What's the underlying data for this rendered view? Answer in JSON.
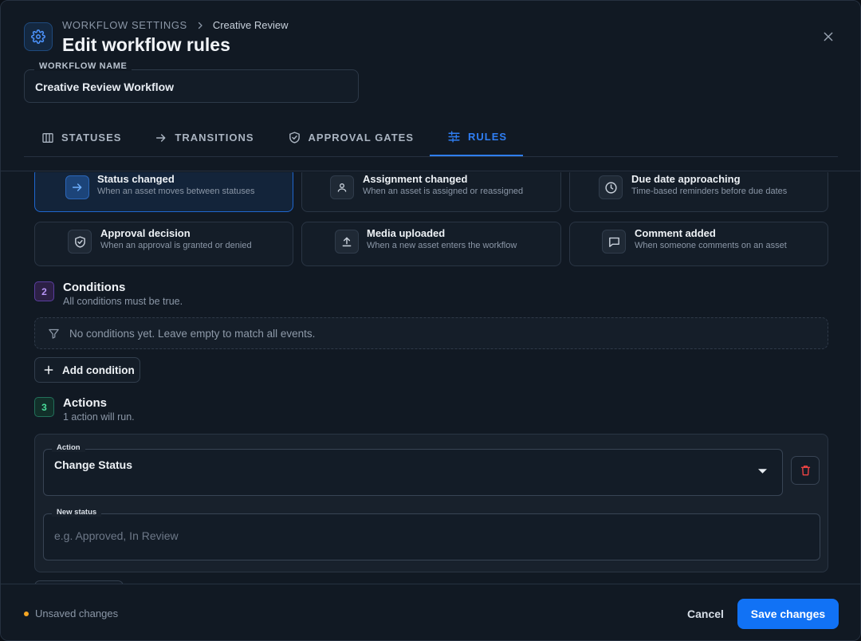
{
  "header": {
    "breadcrumb_root": "WORKFLOW SETTINGS",
    "breadcrumb_current": "Creative Review",
    "title": "Edit workflow rules"
  },
  "workflow_name": {
    "label": "WORKFLOW NAME",
    "value": "Creative Review Workflow"
  },
  "tabs": [
    {
      "label": "STATUSES",
      "icon": "columns-icon"
    },
    {
      "label": "TRANSITIONS",
      "icon": "arrow-right-icon"
    },
    {
      "label": "APPROVAL GATES",
      "icon": "shield-check-icon"
    },
    {
      "label": "RULES",
      "icon": "sliders-icon",
      "active": true
    }
  ],
  "triggers": [
    {
      "name": "Status changed",
      "desc": "When an asset moves between statuses",
      "icon": "arrow-right-icon",
      "selected": true
    },
    {
      "name": "Assignment changed",
      "desc": "When an asset is assigned or reassigned",
      "icon": "user-icon"
    },
    {
      "name": "Due date approaching",
      "desc": "Time-based reminders before due dates",
      "icon": "clock-icon"
    },
    {
      "name": "Approval decision",
      "desc": "When an approval is granted or denied",
      "icon": "shield-check-icon"
    },
    {
      "name": "Media uploaded",
      "desc": "When a new asset enters the workflow",
      "icon": "upload-icon"
    },
    {
      "name": "Comment added",
      "desc": "When someone comments on an asset",
      "icon": "comment-icon"
    }
  ],
  "conditions": {
    "number": "2",
    "title": "Conditions",
    "subtitle": "All conditions must be true.",
    "empty_text": "No conditions yet. Leave empty to match all events.",
    "add_label": "Add condition"
  },
  "actions": {
    "number": "3",
    "title": "Actions",
    "subtitle": "1 action will run.",
    "action_label": "Action",
    "action_value": "Change Status",
    "new_status_label": "New status",
    "new_status_placeholder": "e.g. Approved, In Review",
    "new_status_value": ""
  },
  "footer": {
    "unsaved_text": "Unsaved changes",
    "cancel_label": "Cancel",
    "save_label": "Save changes"
  },
  "colors": {
    "accent": "#1172f5",
    "unsaved_dot": "#f5a623",
    "delete": "#ef4444"
  }
}
